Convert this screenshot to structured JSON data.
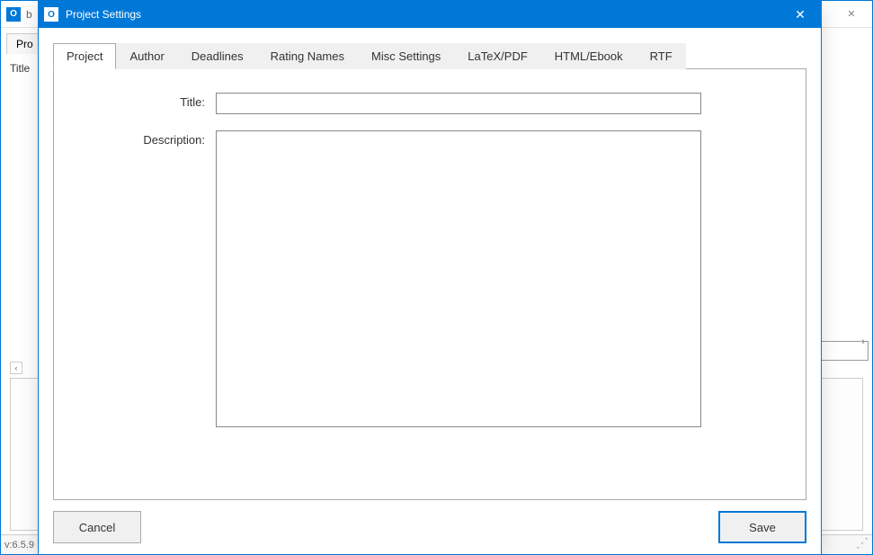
{
  "parent_window": {
    "title_prefix": "b",
    "tab_label": "Pro",
    "side_label": "Title",
    "status_version": "v:6.5.9",
    "close_glyph": "✕"
  },
  "dialog": {
    "title": "Project Settings",
    "close_glyph": "✕",
    "tabs": [
      {
        "label": "Project",
        "active": true
      },
      {
        "label": "Author",
        "active": false
      },
      {
        "label": "Deadlines",
        "active": false
      },
      {
        "label": "Rating Names",
        "active": false
      },
      {
        "label": "Misc Settings",
        "active": false
      },
      {
        "label": "LaTeX/PDF",
        "active": false
      },
      {
        "label": "HTML/Ebook",
        "active": false
      },
      {
        "label": "RTF",
        "active": false
      }
    ],
    "form": {
      "title_label": "Title:",
      "title_value": "",
      "description_label": "Description:",
      "description_value": ""
    },
    "buttons": {
      "cancel": "Cancel",
      "save": "Save"
    }
  }
}
